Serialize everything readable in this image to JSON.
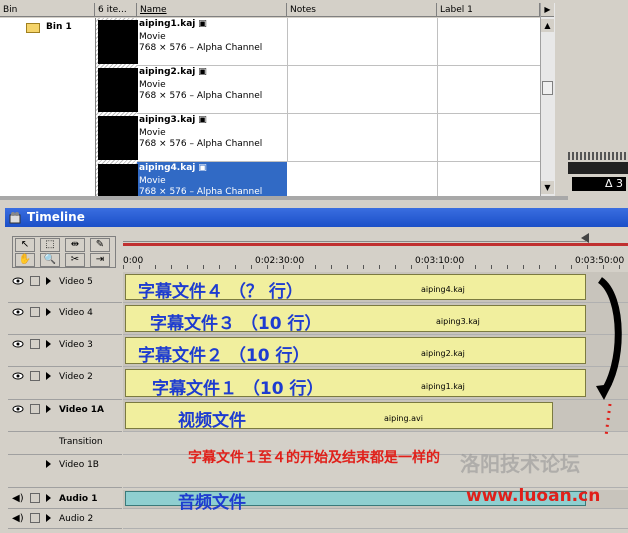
{
  "bin_window": {
    "columns": [
      "Bin",
      "6 ite...",
      "Name",
      "Notes",
      "Label 1"
    ],
    "bin_folder": "Bin 1",
    "clips": [
      {
        "name": "aiping1.kaj",
        "type": "Movie",
        "info": "768 × 576 – Alpha Channel",
        "selected": false
      },
      {
        "name": "aiping2.kaj",
        "type": "Movie",
        "info": "768 × 576 – Alpha Channel",
        "selected": false
      },
      {
        "name": "aiping3.kaj",
        "type": "Movie",
        "info": "768 × 576 – Alpha Channel",
        "selected": false
      },
      {
        "name": "aiping4.kaj",
        "type": "Movie",
        "info": "768 × 576 – Alpha Channel",
        "selected": true
      }
    ]
  },
  "right_strip": {
    "delta": "Δ 3"
  },
  "timeline": {
    "title": "Timeline",
    "ruler": [
      "0:00",
      "0:02:30:00",
      "0:03:10:00",
      "0:03:50:00"
    ],
    "tracks": [
      {
        "name": "Video 5",
        "clip_text": "字幕文件４ （？ 行）",
        "clip_file": "aiping4.kaj"
      },
      {
        "name": "Video 4",
        "clip_text": "字幕文件３ （10 行）",
        "clip_file": "aiping3.kaj"
      },
      {
        "name": "Video 3",
        "clip_text": "字幕文件２ （10 行）",
        "clip_file": "aiping2.kaj"
      },
      {
        "name": "Video 2",
        "clip_text": "字幕文件１ （10 行）",
        "clip_file": "aiping1.kaj"
      },
      {
        "name": "Video 1A",
        "clip_text": "视频文件",
        "clip_file": "aiping.avi"
      },
      {
        "name": "Transition",
        "clip_text": "",
        "clip_file": ""
      },
      {
        "name": "Video 1B",
        "clip_text": "",
        "clip_file": ""
      },
      {
        "name": "Audio 1",
        "clip_text": "音频文件",
        "clip_file": ""
      },
      {
        "name": "Audio 2",
        "clip_text": "",
        "clip_file": ""
      }
    ],
    "annotation": "字幕文件１至４的开始及结束都是一样的",
    "watermark": "www.luoan.cn",
    "watermark_text": "洛阳技术论坛"
  },
  "colors": {
    "title_bar": "#1b4fc8",
    "clip_fill": "#f1ef9e",
    "audio_clip": "#8fcfd0",
    "annotation": "#e0201a",
    "chinese_label": "#1e3cd0",
    "selected_row": "#316ac5"
  }
}
